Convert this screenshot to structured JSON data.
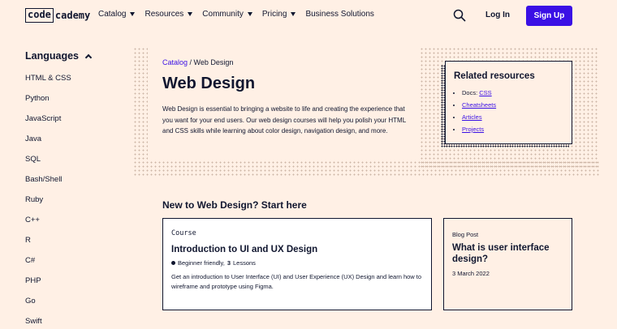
{
  "header": {
    "logo_box": "code",
    "logo_rest": "cademy",
    "nav": [
      "Catalog",
      "Resources",
      "Community",
      "Pricing",
      "Business Solutions"
    ],
    "login": "Log In",
    "signup": "Sign Up"
  },
  "sidebar": {
    "heading": "Languages",
    "items": [
      "HTML & CSS",
      "Python",
      "JavaScript",
      "Java",
      "SQL",
      "Bash/Shell",
      "Ruby",
      "C++",
      "R",
      "C#",
      "PHP",
      "Go",
      "Swift"
    ]
  },
  "hero": {
    "crumb_root": "Catalog",
    "crumb_sep": " / ",
    "crumb_current": "Web Design",
    "title": "Web Design",
    "description": "Web Design is essential to bringing a website to life and creating the experience that you want for your end users. Our web design courses will help you polish your HTML and CSS skills while learning about color design, navigation design, and more."
  },
  "related": {
    "title": "Related resources",
    "docs_prefix": "Docs: ",
    "docs_link": "CSS",
    "links": [
      "Cheatsheets",
      "Articles",
      "Projects"
    ]
  },
  "start": {
    "heading": "New to Web Design? Start here",
    "course": {
      "type": "Course",
      "title": "Introduction to UI and UX Design",
      "level": "Beginner friendly,",
      "lessons_count": "3",
      "lessons_label": "Lessons",
      "description": "Get an introduction to User Interface (UI) and User Experience (UX) Design and learn how to wireframe and prototype using Figma."
    },
    "blog": {
      "type": "Blog Post",
      "title": "What is user interface design?",
      "date": "3 March 2022"
    }
  }
}
